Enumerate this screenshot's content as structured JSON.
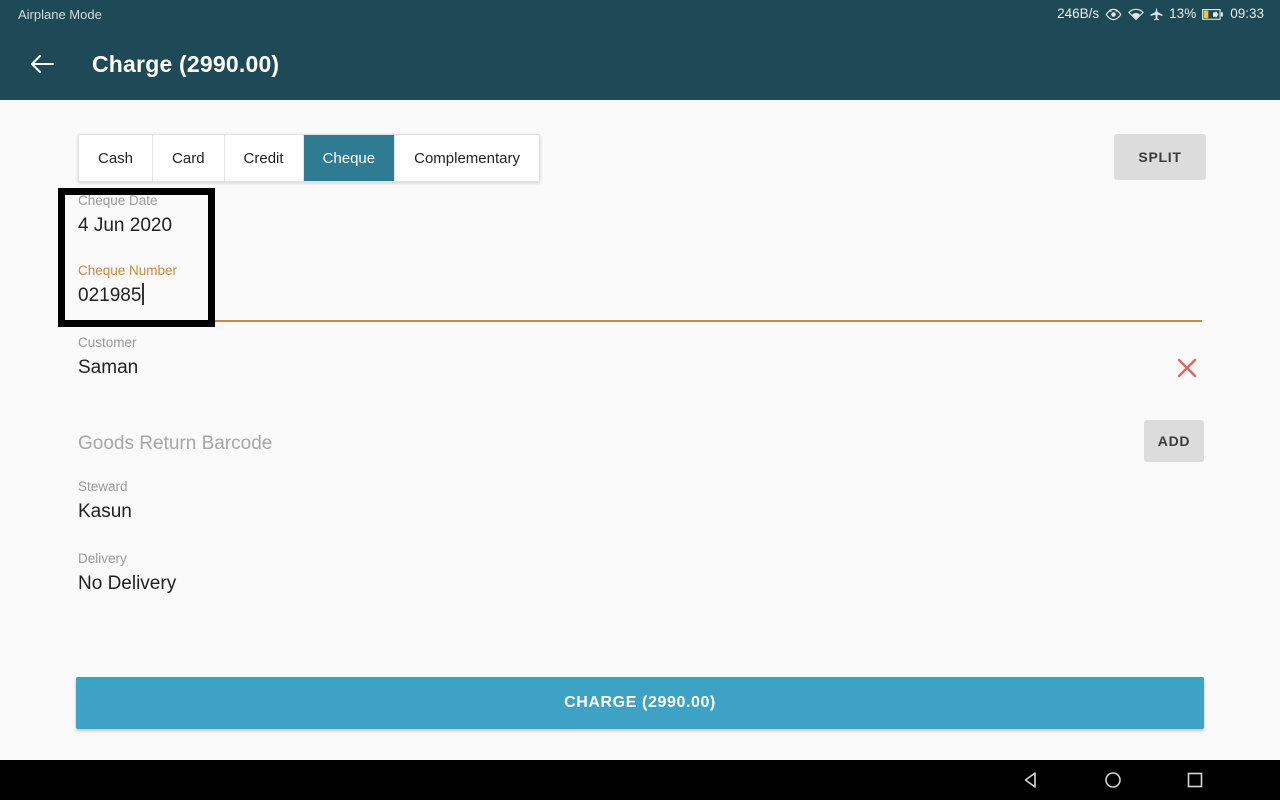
{
  "statusbar": {
    "left_text": "Airplane Mode",
    "network_speed": "246B/s",
    "battery_percent": "13%",
    "clock": "09:33",
    "icons": [
      "eye-icon",
      "wifi-icon",
      "airplane-icon",
      "battery-icon"
    ],
    "background_color": "#1d4a56"
  },
  "appbar": {
    "back_icon": "back-arrow-icon",
    "title": "Charge (2990.00)",
    "background_color": "#1d4a56"
  },
  "tabs": {
    "items": [
      {
        "label": "Cash",
        "selected": false
      },
      {
        "label": "Card",
        "selected": false
      },
      {
        "label": "Credit",
        "selected": false
      },
      {
        "label": "Cheque",
        "selected": true
      },
      {
        "label": "Complementary",
        "selected": false
      }
    ],
    "selected_color": "#2f7b92"
  },
  "toolbar": {
    "split_label": "SPLIT"
  },
  "form": {
    "cheque_date": {
      "label": "Cheque Date",
      "value": "4 Jun 2020"
    },
    "cheque_number": {
      "label": "Cheque Number",
      "value": "021985",
      "label_color": "#d2863a",
      "underline_color": "#d2863a",
      "focused": true
    },
    "customer": {
      "label": "Customer",
      "value": "Saman",
      "clear_icon": "close-x-icon",
      "clear_icon_color": "#e06666"
    },
    "goods_return_barcode": {
      "placeholder": "Goods Return Barcode",
      "value": "",
      "add_label": "ADD"
    },
    "steward": {
      "label": "Steward",
      "value": "Kasun"
    },
    "delivery": {
      "label": "Delivery",
      "value": "No Delivery"
    }
  },
  "charge_button": {
    "label": "CHARGE (2990.00)",
    "color": "#3ea2c4"
  },
  "navbar": {
    "back_icon": "nav-back-triangle-icon",
    "home_icon": "nav-home-circle-icon",
    "recents_icon": "nav-recents-square-icon"
  }
}
